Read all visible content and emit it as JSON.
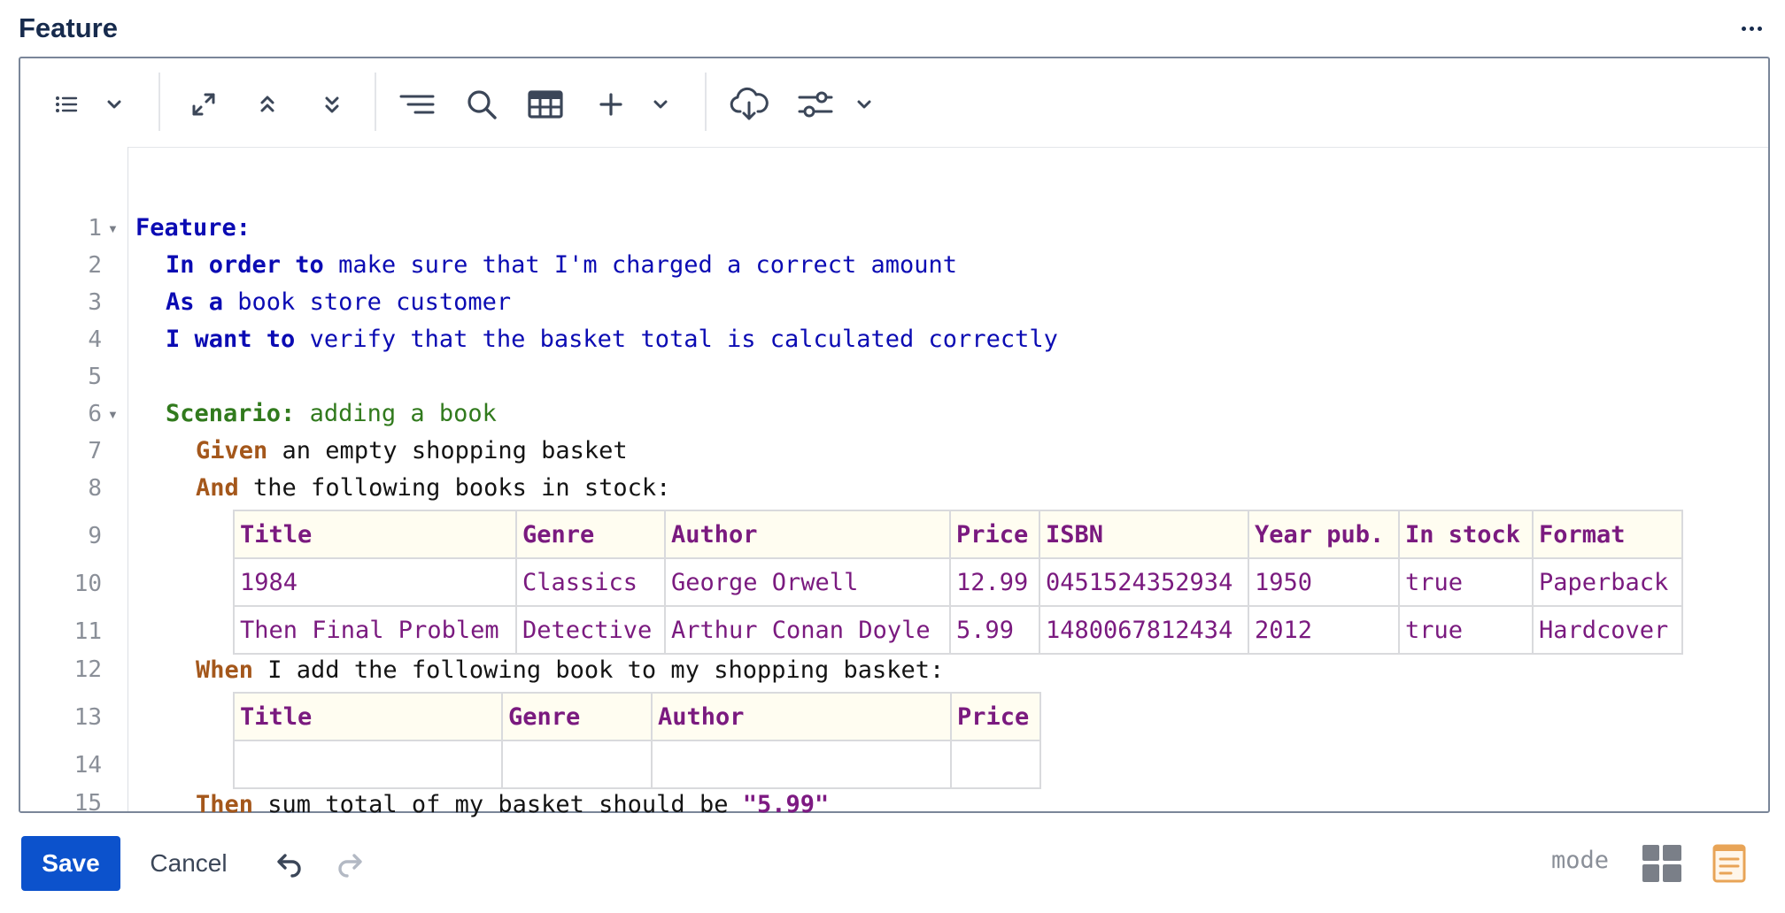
{
  "header": {
    "title": "Feature",
    "more_icon": "more-horizontal-icon"
  },
  "toolbar": {
    "groups": [
      [
        "list-icon",
        "chevron-down-icon"
      ],
      [
        "expand-icon",
        "collapse-up-icon",
        "collapse-down-icon"
      ],
      [
        "align-right-lines-icon",
        "search-icon",
        "table-icon",
        "plus-icon",
        "chevron-down-icon"
      ],
      [
        "cloud-download-icon",
        "sliders-icon",
        "chevron-down-icon"
      ]
    ]
  },
  "editor": {
    "line_numbers": [
      "1",
      "2",
      "3",
      "4",
      "5",
      "6",
      "7",
      "8",
      "9",
      "10",
      "11",
      "12",
      "13",
      "14",
      "15"
    ],
    "lines": {
      "l1": {
        "kw": "Feature:"
      },
      "l2": {
        "kw": "In order to",
        "text": " make sure that I'm charged a correct amount"
      },
      "l3": {
        "kw": "As a",
        "text": " book store customer"
      },
      "l4": {
        "kw": "I want to",
        "text": " verify that the basket total is calculated correctly"
      },
      "l6": {
        "kw": "Scenario:",
        "text": " adding a book"
      },
      "l7": {
        "kw": "Given",
        "text": " an empty shopping basket"
      },
      "l8": {
        "kw": "And",
        "text": " the following books in stock:"
      },
      "l12": {
        "kw": "When",
        "text": " I add the following book to my shopping basket:"
      },
      "l15": {
        "kw": "Then",
        "text": " sum total of my basket should be ",
        "str": "\"5.99\""
      }
    },
    "table1": {
      "headers": [
        "Title",
        "Genre",
        "Author",
        "Price",
        "ISBN",
        "Year pub.",
        "In stock",
        "Format"
      ],
      "rows": [
        [
          "1984",
          "Classics",
          "George Orwell",
          "12.99",
          "0451524352934",
          "1950",
          "true",
          "Paperback"
        ],
        [
          "Then Final Problem",
          "Detective",
          "Arthur Conan Doyle",
          "5.99",
          "1480067812434",
          "2012",
          "true",
          "Hardcover"
        ]
      ]
    },
    "table2": {
      "headers": [
        "Title",
        "Genre",
        "Author",
        "Price"
      ],
      "rows": [
        [
          "",
          "",
          "",
          ""
        ]
      ]
    }
  },
  "footer": {
    "save_label": "Save",
    "cancel_label": "Cancel",
    "mode_label": "mode",
    "icons": [
      "undo-icon",
      "redo-icon",
      "grid-mode-icon",
      "document-mode-icon"
    ]
  },
  "colors": {
    "keyword_blue": "#0b0bb3",
    "scenario_green": "#317a1d",
    "step_orange": "#a4571b",
    "table_purple": "#7a1a7f",
    "save_blue": "#0c52cc",
    "doc_icon_orange": "#e8a457"
  }
}
